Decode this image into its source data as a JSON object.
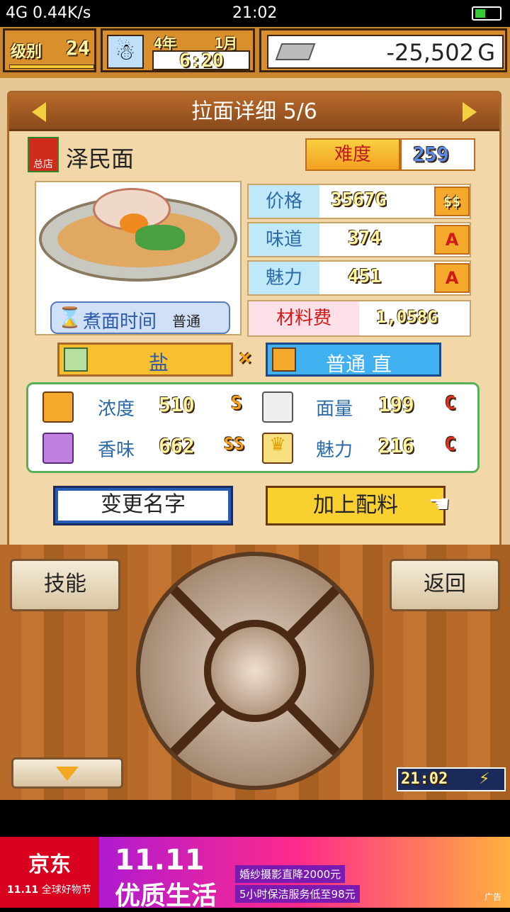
{
  "status": {
    "net": "0.44K/s",
    "signal": "4G",
    "time": "21:02"
  },
  "hud": {
    "level_label": "级别",
    "level": "24",
    "year": "4",
    "year_unit": "年",
    "month": "1",
    "month_unit": "月",
    "clock": "6:20",
    "money": "-25,502",
    "money_unit": "G"
  },
  "panel": {
    "title": "拉面详细 5/6",
    "shop_badge": "总店",
    "ramen_name": "泽民面",
    "difficulty_label": "难度",
    "difficulty": "259",
    "cook_time_label": "煮面时间",
    "cook_time_value": "普通",
    "stats": [
      {
        "label": "价格",
        "value": "3567G",
        "grade": "$$"
      },
      {
        "label": "味道",
        "value": "374",
        "grade": "A"
      },
      {
        "label": "魅力",
        "value": "451",
        "grade": "A"
      }
    ],
    "cost_label": "材料费",
    "cost_value": "1,058G",
    "soup": "盐",
    "times": "×",
    "noodle": "普通 直",
    "attrs": [
      {
        "label": "浓度",
        "value": "510",
        "grade": "S"
      },
      {
        "label": "面量",
        "value": "199",
        "grade": "C"
      },
      {
        "label": "香味",
        "value": "662",
        "grade": "SS"
      },
      {
        "label": "魅力",
        "value": "216",
        "grade": "C"
      }
    ],
    "rename_button": "变更名字",
    "add_topping_button": "加上配料"
  },
  "controls": {
    "skill": "技能",
    "back": "返回",
    "clock": "21:02"
  },
  "ad": {
    "brand": "京东",
    "sub": "全球好物节",
    "big1": "11.11",
    "big2": "优质生活",
    "line1": "婚纱摄影直降2000元",
    "line2": "5小时保洁服务低至98元",
    "tag": "广告",
    "jd_date": "11.11"
  }
}
